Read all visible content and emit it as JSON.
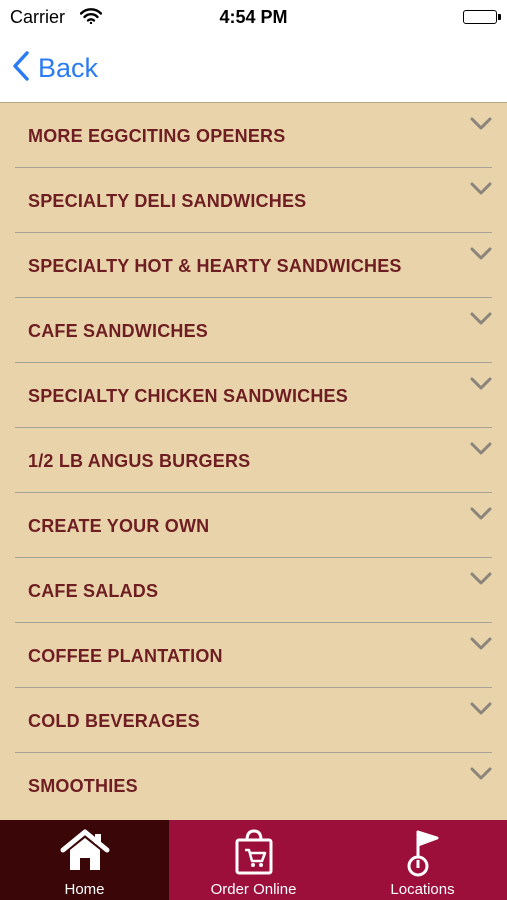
{
  "status_bar": {
    "carrier": "Carrier",
    "time": "4:54 PM"
  },
  "nav": {
    "back_label": "Back"
  },
  "menu": {
    "items": [
      {
        "label": "MORE EGGCITING OPENERS"
      },
      {
        "label": "SPECIALTY DELI SANDWICHES"
      },
      {
        "label": "SPECIALTY HOT & HEARTY SANDWICHES"
      },
      {
        "label": "CAFE SANDWICHES"
      },
      {
        "label": "SPECIALTY CHICKEN SANDWICHES"
      },
      {
        "label": "1/2 LB ANGUS BURGERS"
      },
      {
        "label": "CREATE YOUR OWN"
      },
      {
        "label": "CAFE SALADS"
      },
      {
        "label": "COFFEE PLANTATION"
      },
      {
        "label": "COLD BEVERAGES"
      },
      {
        "label": "SMOOTHIES"
      }
    ]
  },
  "tabs": [
    {
      "label": "Home",
      "icon": "home-icon",
      "selected": true
    },
    {
      "label": "Order Online",
      "icon": "shopping-bag-icon",
      "selected": false
    },
    {
      "label": "Locations",
      "icon": "location-flag-icon",
      "selected": false
    }
  ],
  "colors": {
    "background": "#e8d3aa",
    "menu_text": "#6e1e22",
    "tab_bar": "#9c0f3a",
    "tab_selected": "#3a0608",
    "link_blue": "#2b7cf3"
  }
}
